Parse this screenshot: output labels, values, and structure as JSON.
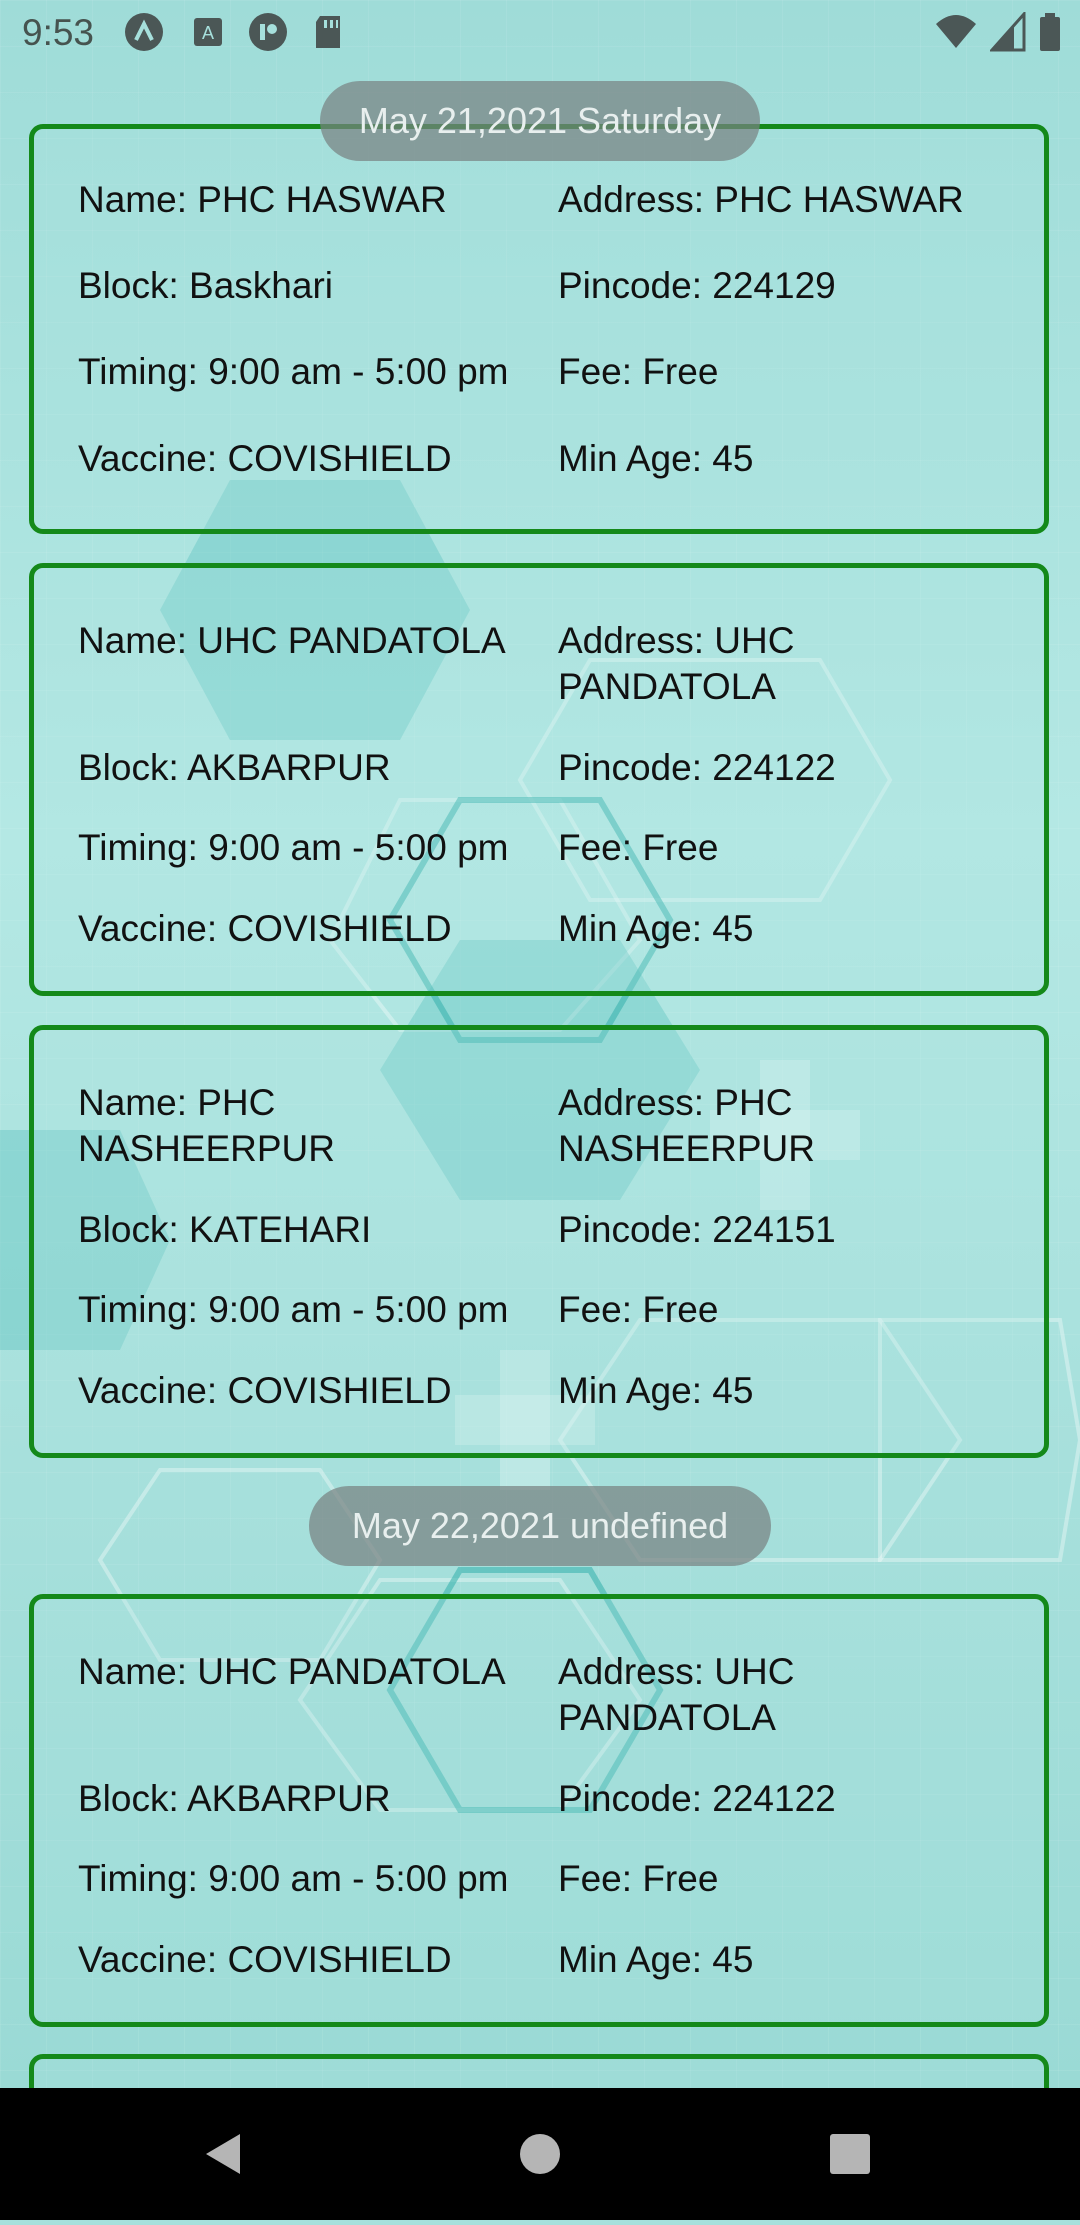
{
  "status_bar": {
    "time": "9:53",
    "left_icons": [
      "app-a-icon",
      "app-keyboard-icon",
      "app-p-icon",
      "sd-card-icon"
    ],
    "right_icons": [
      "wifi-icon",
      "cell-signal-icon",
      "battery-icon"
    ]
  },
  "groups": [
    {
      "date_label": "May 21,2021 Saturday",
      "centers": [
        {
          "name": "Name: PHC HASWAR",
          "address": "Address: PHC HASWAR",
          "block": "Block: Baskhari",
          "pincode": "Pincode: 224129",
          "timing": "Timing: 9:00 am - 5:00 pm",
          "fee": "Fee: Free",
          "vaccine": "Vaccine: COVISHIELD",
          "min_age": "Min Age: 45"
        },
        {
          "name": "Name: UHC PANDATOLA",
          "address": "Address: UHC PANDATOLA",
          "block": "Block: AKBARPUR",
          "pincode": "Pincode: 224122",
          "timing": "Timing: 9:00 am - 5:00 pm",
          "fee": "Fee: Free",
          "vaccine": "Vaccine: COVISHIELD",
          "min_age": "Min Age: 45"
        },
        {
          "name": "Name: PHC NASHEERPUR",
          "address": "Address: PHC NASHEERPUR",
          "block": "Block: KATEHARI",
          "pincode": "Pincode: 224151",
          "timing": "Timing: 9:00 am - 5:00 pm",
          "fee": "Fee: Free",
          "vaccine": "Vaccine: COVISHIELD",
          "min_age": "Min Age: 45"
        }
      ]
    },
    {
      "date_label": "May 22,2021 undefined",
      "centers": [
        {
          "name": "Name: UHC PANDATOLA",
          "address": "Address: UHC PANDATOLA",
          "block": "Block: AKBARPUR",
          "pincode": "Pincode: 224122",
          "timing": "Timing: 9:00 am - 5:00 pm",
          "fee": "Fee: Free",
          "vaccine": "Vaccine: COVISHIELD",
          "min_age": "Min Age: 45"
        }
      ]
    }
  ],
  "nav_bar": {
    "buttons": [
      "back-icon",
      "home-icon",
      "recents-icon"
    ]
  },
  "colors": {
    "card_border": "#14891a",
    "background": "#a6e0dc",
    "chip": "#7a8282"
  }
}
